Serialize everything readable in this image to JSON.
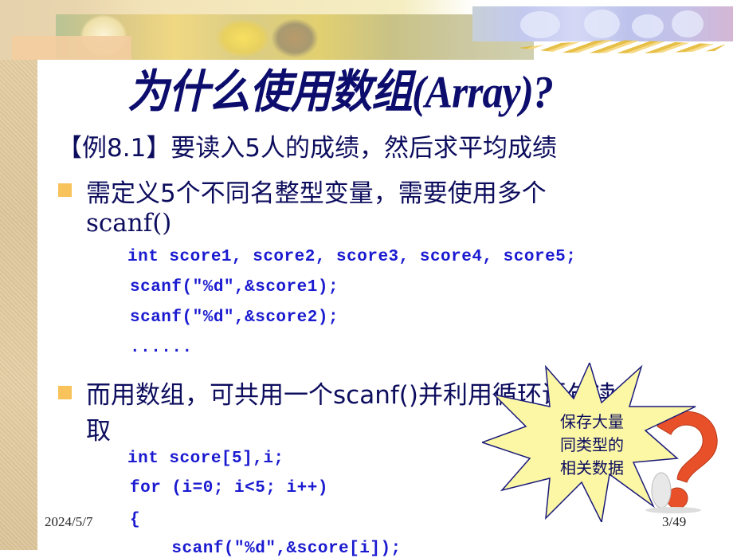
{
  "slide": {
    "title_cn": "为什么使用数组",
    "title_en": "(Array)?",
    "example_line": "【例8.1】要读入5人的成绩，然后求平均成绩",
    "bullets": [
      {
        "line1": "需定义5个不同名整型变量，需要使用多个",
        "line2": "scanf()",
        "code": [
          "int score1, score2, score3, score4, score5;",
          "scanf(\"%d\",&score1);",
          "scanf(\"%d\",&score2);",
          "......"
        ]
      },
      {
        "line1": "而用数组，可共用一个scanf()并利用循环语句读",
        "line2": "取",
        "code": [
          "int score[5],i;",
          "for (i=0; i<5; i++)",
          "{",
          "    scanf(\"%d\",&score[i]);"
        ]
      }
    ],
    "callout": {
      "lines": [
        "保存大量",
        "同类型的",
        "相关数据"
      ],
      "fill_color": "#fbf7a5",
      "border_color": "#1a1a7a"
    },
    "footer": {
      "date": "2024/5/7",
      "page": "3/49"
    },
    "colors": {
      "title": "#0d0d6e",
      "text": "#0d0d5e",
      "code": "#1a1ad0",
      "bullet": "#f7c35a",
      "question_mark": "#e8502a"
    },
    "decor": {
      "question_mark_icon": "red-question-mark-with-figure"
    }
  }
}
